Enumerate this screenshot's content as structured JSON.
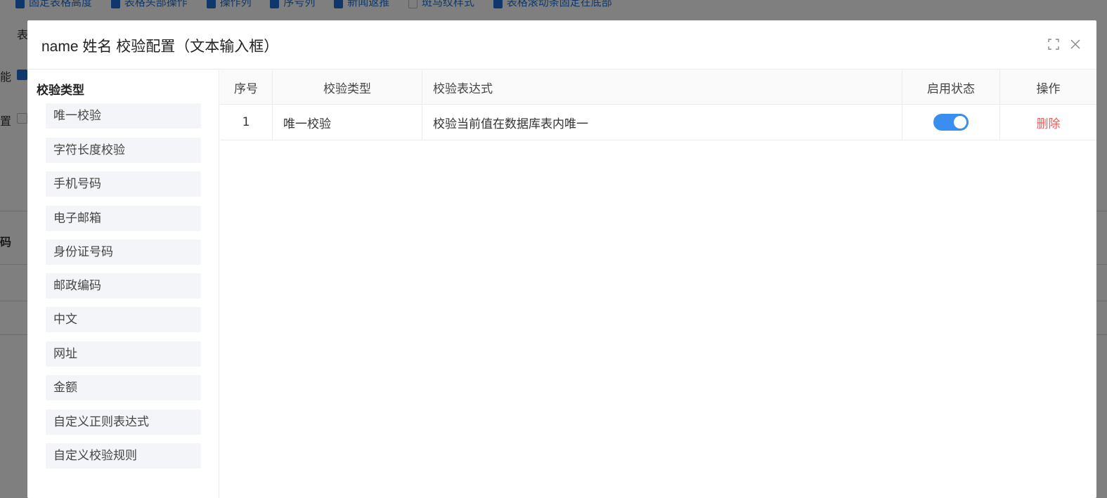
{
  "background": {
    "checkbox_row": [
      {
        "label": "固定表格高度",
        "checked": true
      },
      {
        "label": "表格头部操作",
        "checked": true
      },
      {
        "label": "操作列",
        "checked": true
      },
      {
        "label": "序号列",
        "checked": true
      },
      {
        "label": "新闻返推",
        "checked": true
      },
      {
        "label": "斑马纹样式",
        "checked": false
      },
      {
        "label": "表格滚动条固定在底部",
        "checked": true
      }
    ],
    "label_biao": "表",
    "label_neng": "能",
    "label_zhi": "置",
    "label_ma": "码"
  },
  "dialog": {
    "title": "name 姓名 校验配置（文本输入框）",
    "maximize_icon": "fullscreen-icon",
    "close_icon": "close-icon"
  },
  "left_panel": {
    "title": "校验类型",
    "items": [
      "唯一校验",
      "字符长度校验",
      "手机号码",
      "电子邮箱",
      "身份证号码",
      "邮政编码",
      "中文",
      "网址",
      "金额",
      "自定义正则表达式",
      "自定义校验规则"
    ]
  },
  "table": {
    "columns": [
      "序号",
      "校验类型",
      "校验表达式",
      "启用状态",
      "操作"
    ],
    "rows": [
      {
        "index": "1",
        "type": "唯一校验",
        "expression": "校验当前值在数据库表内唯一",
        "enabled": true,
        "action": "删除"
      }
    ]
  },
  "colors": {
    "accent": "#3a8ef0",
    "danger": "#f25b5b",
    "item_bg": "#f4f5f9"
  }
}
